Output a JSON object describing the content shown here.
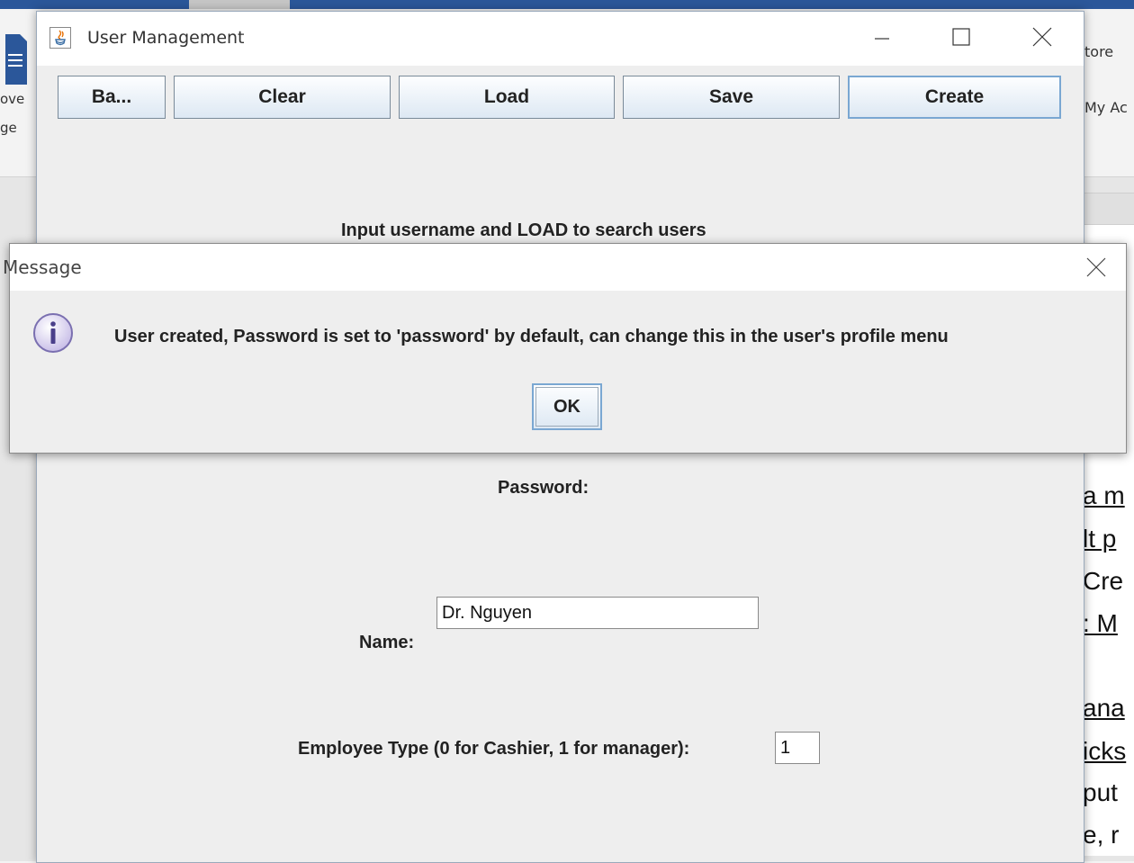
{
  "background_app": {
    "left_texts": [
      "ove",
      "ge"
    ],
    "right_texts": [
      "tore",
      "My Ac"
    ],
    "doc_lines": [
      "a m",
      "lt p",
      "Cre",
      ": M",
      "ana",
      "icks",
      "put",
      "e, r"
    ]
  },
  "user_management": {
    "title": "User Management",
    "toolbar": {
      "back_label": "Ba...",
      "clear_label": "Clear",
      "load_label": "Load",
      "save_label": "Save",
      "create_label": "Create"
    },
    "instruction": "Input username and LOAD to search users",
    "password_label": "Password:",
    "name_label": "Name:",
    "name_value": "Dr. Nguyen",
    "employee_type_label": "Employee Type (0 for Cashier, 1 for manager):",
    "employee_type_value": "1"
  },
  "message_dialog": {
    "title": "Message",
    "icon": "info-icon",
    "text": "User created, Password is set to 'password' by default, can change this in the user's profile menu",
    "ok_label": "OK"
  },
  "colors": {
    "button_border_focus": "#7aa7d2",
    "title_bar_bg": "#ffffff",
    "window_bg": "#eeeeee",
    "info_icon_fill": "#d9d2f0"
  }
}
